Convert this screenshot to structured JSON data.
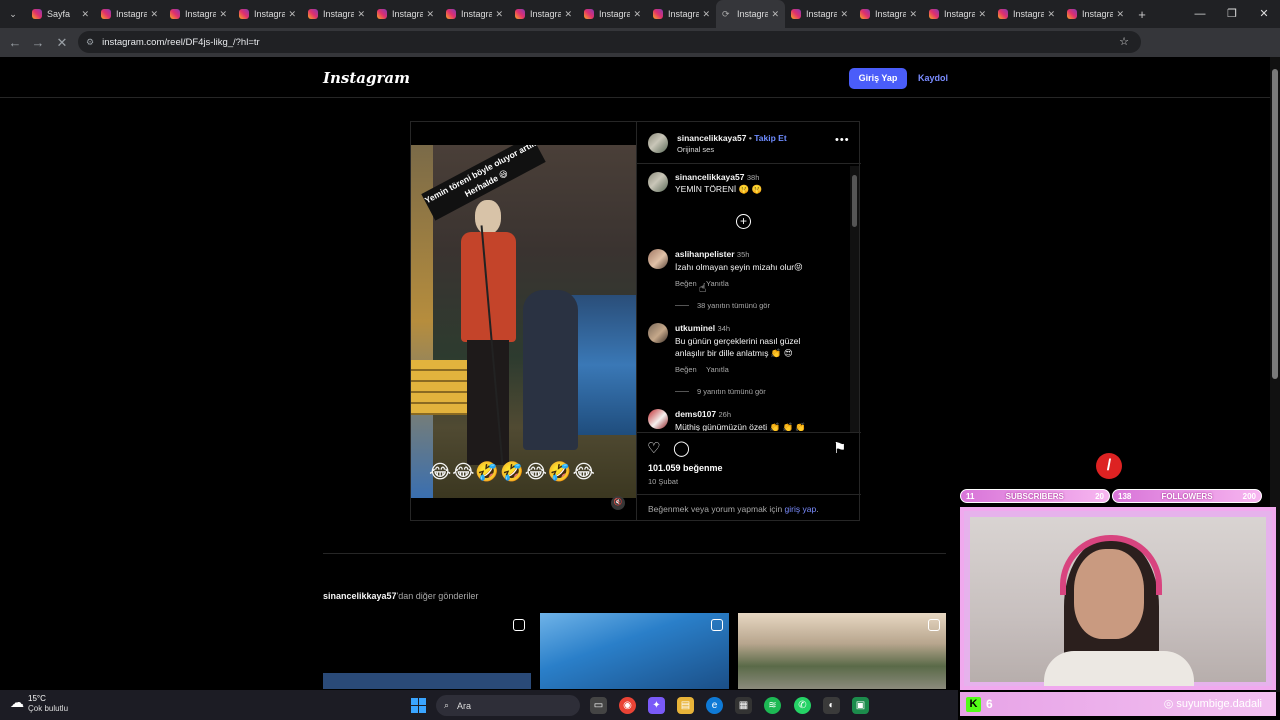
{
  "browser": {
    "tabs": [
      {
        "label": "Sayfa",
        "active": false
      },
      {
        "label": "Instagram",
        "active": false
      },
      {
        "label": "Instagram",
        "active": false
      },
      {
        "label": "Instagram",
        "active": false
      },
      {
        "label": "Instagram",
        "active": false
      },
      {
        "label": "Instagram",
        "active": false
      },
      {
        "label": "Instagram",
        "active": false
      },
      {
        "label": "Instagram",
        "active": false
      },
      {
        "label": "Instagram",
        "active": false
      },
      {
        "label": "Instagram",
        "active": false
      },
      {
        "label": "Instagram",
        "active": true
      },
      {
        "label": "Instagram",
        "active": false
      },
      {
        "label": "Instagram",
        "active": false
      },
      {
        "label": "Instagram",
        "active": false
      },
      {
        "label": "Instagram",
        "active": false
      },
      {
        "label": "Instagram",
        "active": false
      }
    ],
    "url": "instagram.com/reel/DF4js-likg_/?hl=tr",
    "profile_initial": "S"
  },
  "header": {
    "logo": "Instagram",
    "login_label": "Giriş Yap",
    "signup_label": "Kaydol"
  },
  "post": {
    "video_banner": "Yemin töreni böyle oluyor artık Herhalde 😆",
    "video_emojis": "😂😂🤣🤣😂🤣😂",
    "author": "sinancelikkaya57",
    "separator": "•",
    "follow_label": "Takip Et",
    "audio": "Orijinal ses",
    "caption": {
      "user": "sinancelikkaya57",
      "time": "38h",
      "text": "YEMİN TÖRENİ 🤫 🤫"
    },
    "comments": [
      {
        "user": "aslihanpelister",
        "time": "35h",
        "text": "İzahı olmayan şeyin mizahı olur😝",
        "text2": "",
        "like_label": "Beğen",
        "reply_label": "Yanıtla",
        "replies": "38 yanıtın tümünü gör"
      },
      {
        "user": "utkuminel",
        "time": "34h",
        "text": "Bu günün gerçeklerini nasıl güzel",
        "text2": "anlaşılır bir dille anlatmış 👏 😍",
        "like_label": "Beğen",
        "reply_label": "Yanıtla",
        "replies": "9 yanıtın tümünü gör"
      },
      {
        "user": "dems0107",
        "time": "26h",
        "text": "Müthiş günümüzün özeti 👏 👏 👏",
        "text2": "",
        "like_label": "",
        "reply_label": "",
        "replies": ""
      }
    ],
    "likes": "101.059 beğenme",
    "date": "10 Şubat",
    "login_prompt": "Beğenmek veya yorum yapmak için",
    "login_prompt_link": "giriş yap",
    "login_prompt_end": "."
  },
  "more_posts": {
    "user": "sinancelikkaya57",
    "suffix": "'dan diğer gönderiler"
  },
  "stream": {
    "subs_left": "11",
    "subs_label": "SUBSCRIBERS",
    "subs_right": "20",
    "followers_left": "138",
    "followers_label": "FOLLOWERS",
    "followers_right": "200",
    "kick_count": "6",
    "handle": "suyumbige.dadali"
  },
  "taskbar": {
    "temp": "15°C",
    "weather": "Çok bulutlu",
    "search_placeholder": "Ara"
  }
}
